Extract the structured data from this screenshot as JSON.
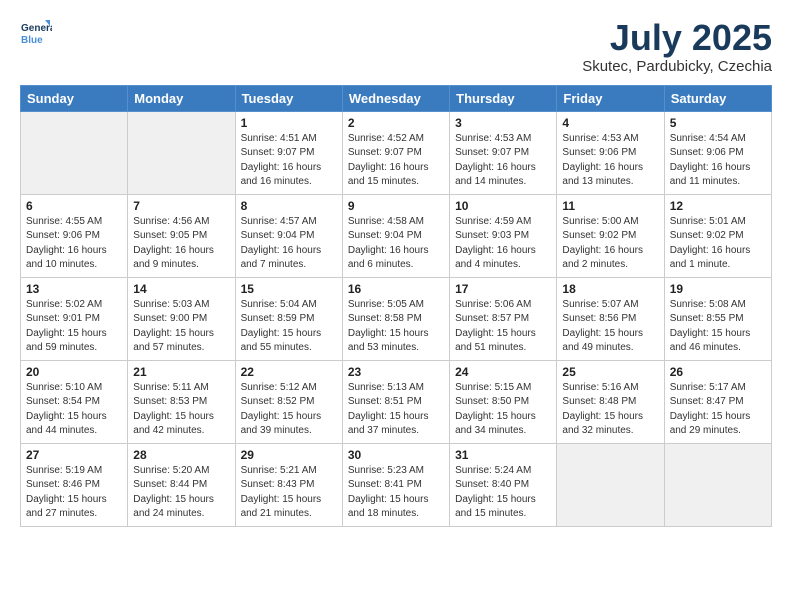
{
  "logo": {
    "line1": "General",
    "line2": "Blue"
  },
  "title": "July 2025",
  "subtitle": "Skutec, Pardubicky, Czechia",
  "days_header": [
    "Sunday",
    "Monday",
    "Tuesday",
    "Wednesday",
    "Thursday",
    "Friday",
    "Saturday"
  ],
  "weeks": [
    [
      {
        "day": "",
        "empty": true
      },
      {
        "day": "",
        "empty": true
      },
      {
        "day": "1",
        "sunrise": "4:51 AM",
        "sunset": "9:07 PM",
        "daylight": "16 hours and 16 minutes."
      },
      {
        "day": "2",
        "sunrise": "4:52 AM",
        "sunset": "9:07 PM",
        "daylight": "16 hours and 15 minutes."
      },
      {
        "day": "3",
        "sunrise": "4:53 AM",
        "sunset": "9:07 PM",
        "daylight": "16 hours and 14 minutes."
      },
      {
        "day": "4",
        "sunrise": "4:53 AM",
        "sunset": "9:06 PM",
        "daylight": "16 hours and 13 minutes."
      },
      {
        "day": "5",
        "sunrise": "4:54 AM",
        "sunset": "9:06 PM",
        "daylight": "16 hours and 11 minutes."
      }
    ],
    [
      {
        "day": "6",
        "sunrise": "4:55 AM",
        "sunset": "9:06 PM",
        "daylight": "16 hours and 10 minutes."
      },
      {
        "day": "7",
        "sunrise": "4:56 AM",
        "sunset": "9:05 PM",
        "daylight": "16 hours and 9 minutes."
      },
      {
        "day": "8",
        "sunrise": "4:57 AM",
        "sunset": "9:04 PM",
        "daylight": "16 hours and 7 minutes."
      },
      {
        "day": "9",
        "sunrise": "4:58 AM",
        "sunset": "9:04 PM",
        "daylight": "16 hours and 6 minutes."
      },
      {
        "day": "10",
        "sunrise": "4:59 AM",
        "sunset": "9:03 PM",
        "daylight": "16 hours and 4 minutes."
      },
      {
        "day": "11",
        "sunrise": "5:00 AM",
        "sunset": "9:02 PM",
        "daylight": "16 hours and 2 minutes."
      },
      {
        "day": "12",
        "sunrise": "5:01 AM",
        "sunset": "9:02 PM",
        "daylight": "16 hours and 1 minute."
      }
    ],
    [
      {
        "day": "13",
        "sunrise": "5:02 AM",
        "sunset": "9:01 PM",
        "daylight": "15 hours and 59 minutes."
      },
      {
        "day": "14",
        "sunrise": "5:03 AM",
        "sunset": "9:00 PM",
        "daylight": "15 hours and 57 minutes."
      },
      {
        "day": "15",
        "sunrise": "5:04 AM",
        "sunset": "8:59 PM",
        "daylight": "15 hours and 55 minutes."
      },
      {
        "day": "16",
        "sunrise": "5:05 AM",
        "sunset": "8:58 PM",
        "daylight": "15 hours and 53 minutes."
      },
      {
        "day": "17",
        "sunrise": "5:06 AM",
        "sunset": "8:57 PM",
        "daylight": "15 hours and 51 minutes."
      },
      {
        "day": "18",
        "sunrise": "5:07 AM",
        "sunset": "8:56 PM",
        "daylight": "15 hours and 49 minutes."
      },
      {
        "day": "19",
        "sunrise": "5:08 AM",
        "sunset": "8:55 PM",
        "daylight": "15 hours and 46 minutes."
      }
    ],
    [
      {
        "day": "20",
        "sunrise": "5:10 AM",
        "sunset": "8:54 PM",
        "daylight": "15 hours and 44 minutes."
      },
      {
        "day": "21",
        "sunrise": "5:11 AM",
        "sunset": "8:53 PM",
        "daylight": "15 hours and 42 minutes."
      },
      {
        "day": "22",
        "sunrise": "5:12 AM",
        "sunset": "8:52 PM",
        "daylight": "15 hours and 39 minutes."
      },
      {
        "day": "23",
        "sunrise": "5:13 AM",
        "sunset": "8:51 PM",
        "daylight": "15 hours and 37 minutes."
      },
      {
        "day": "24",
        "sunrise": "5:15 AM",
        "sunset": "8:50 PM",
        "daylight": "15 hours and 34 minutes."
      },
      {
        "day": "25",
        "sunrise": "5:16 AM",
        "sunset": "8:48 PM",
        "daylight": "15 hours and 32 minutes."
      },
      {
        "day": "26",
        "sunrise": "5:17 AM",
        "sunset": "8:47 PM",
        "daylight": "15 hours and 29 minutes."
      }
    ],
    [
      {
        "day": "27",
        "sunrise": "5:19 AM",
        "sunset": "8:46 PM",
        "daylight": "15 hours and 27 minutes."
      },
      {
        "day": "28",
        "sunrise": "5:20 AM",
        "sunset": "8:44 PM",
        "daylight": "15 hours and 24 minutes."
      },
      {
        "day": "29",
        "sunrise": "5:21 AM",
        "sunset": "8:43 PM",
        "daylight": "15 hours and 21 minutes."
      },
      {
        "day": "30",
        "sunrise": "5:23 AM",
        "sunset": "8:41 PM",
        "daylight": "15 hours and 18 minutes."
      },
      {
        "day": "31",
        "sunrise": "5:24 AM",
        "sunset": "8:40 PM",
        "daylight": "15 hours and 15 minutes."
      },
      {
        "day": "",
        "empty": true
      },
      {
        "day": "",
        "empty": true
      }
    ]
  ]
}
